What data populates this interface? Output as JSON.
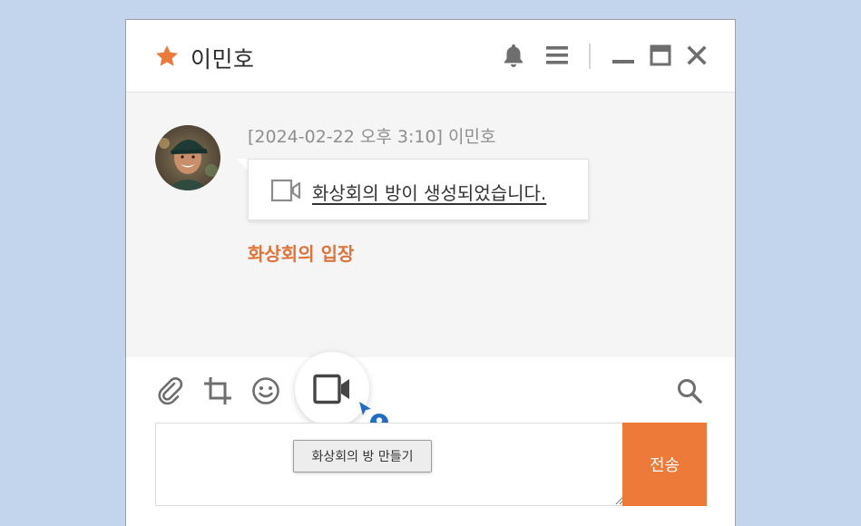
{
  "window": {
    "title": "이민호",
    "icons": [
      "star-icon",
      "bell-icon",
      "menu-icon",
      "minimize-icon",
      "maximize-icon",
      "close-icon"
    ]
  },
  "colors": {
    "accent": "#ee7a3a",
    "join_link": "#e0733a",
    "chat_bg": "#f5f5f5",
    "desktop_bg": "#c3d5ec"
  },
  "message": {
    "meta": "[2024-02-22 오후 3:10] 이민호",
    "text": "화상회의 방이 생성되었습니다.",
    "icon": "video-camera-icon",
    "join_label": "화상회의 입장"
  },
  "toolbar": {
    "tools": [
      "paperclip-icon",
      "crop-icon",
      "emoji-icon",
      "video-camera-icon",
      "search-icon"
    ],
    "tooltip": "화상회의 방 만들기"
  },
  "composer": {
    "input_value": "",
    "send_label": "전송"
  }
}
